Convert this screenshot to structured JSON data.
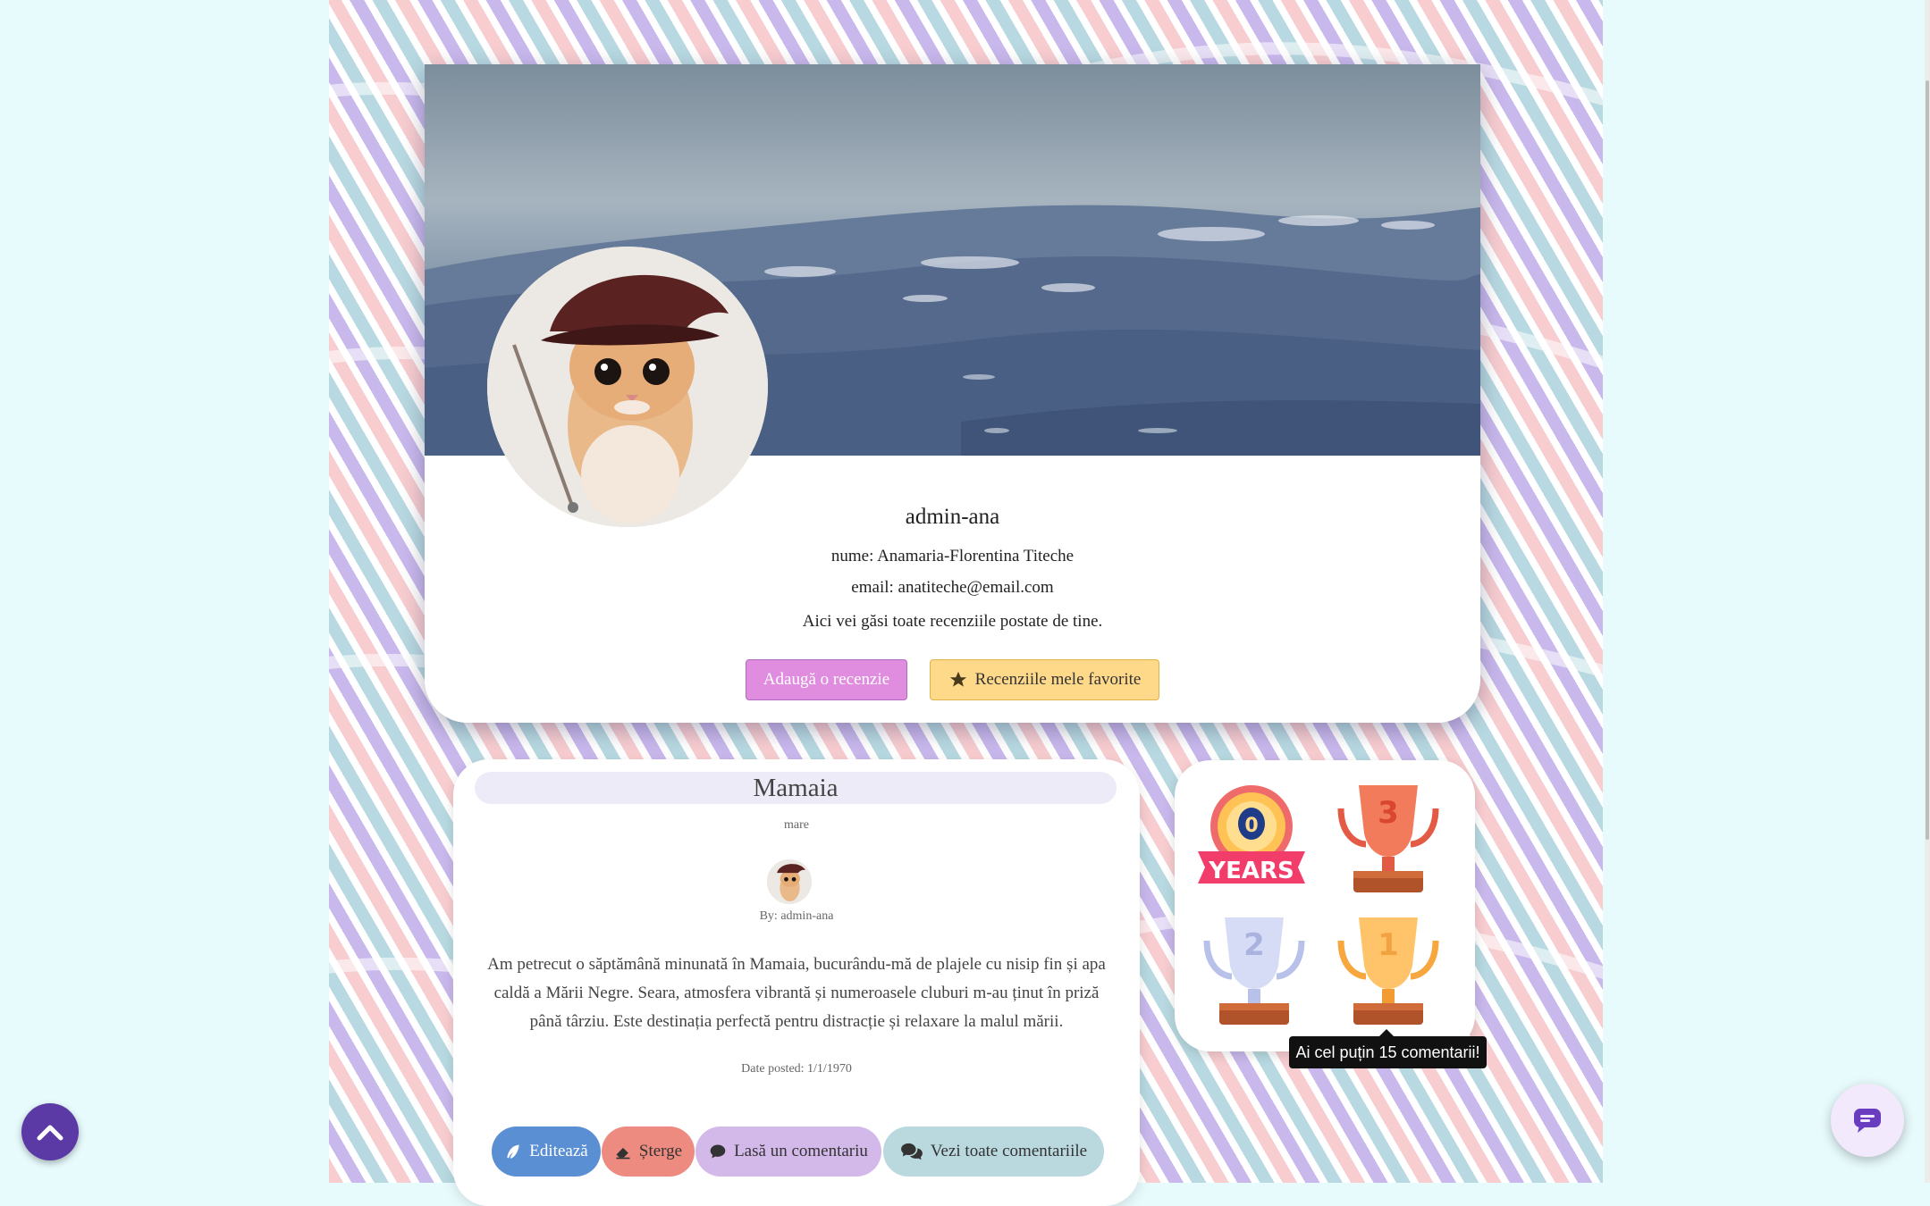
{
  "profile": {
    "username": "admin-ana",
    "name_line": "nume: Anamaria-Florentina Titeche",
    "email_line": "email: anatiteche@email.com",
    "description": "Aici vei găsi toate recenziile postate de tine.",
    "add_review_label": "Adaugă o recenzie",
    "favorites_label": "Recenziile mele favorite"
  },
  "review": {
    "title": "Mamaia",
    "tag": "mare",
    "author": "By: admin-ana",
    "text": "Am petrecut o săptămână minunată în Mamaia, bucurându-mă de plajele cu nisip fin și apa caldă a Mării Negre. Seara, atmosfera vibrantă și numeroasele cluburi m-au ținut în priză până târziu. Este destinația perfectă pentru distracție și relaxare la malul mării.",
    "date": "Date posted: 1/1/1970",
    "edit_label": "Editează",
    "delete_label": "Șterge",
    "comment_label": "Lasă un comentariu",
    "all_comments_label": "Vezi toate comentariile"
  },
  "awards": {
    "years_badge_number": "0",
    "years_badge_text": "YEARS",
    "trophy_bronze_number": "3",
    "trophy_silver_number": "2",
    "trophy_gold_number": "1",
    "tooltip": "Ai cel puțin 15 comentarii!"
  },
  "colors": {
    "accent_purple": "#5b3aa6",
    "add_button": "#e08de0",
    "favorites_button": "#ffd98a",
    "edit_button": "#5b8fd4",
    "delete_button": "#ee8b80",
    "comment_button": "#d3b8ea",
    "all_comments_button": "#b9d9df"
  }
}
